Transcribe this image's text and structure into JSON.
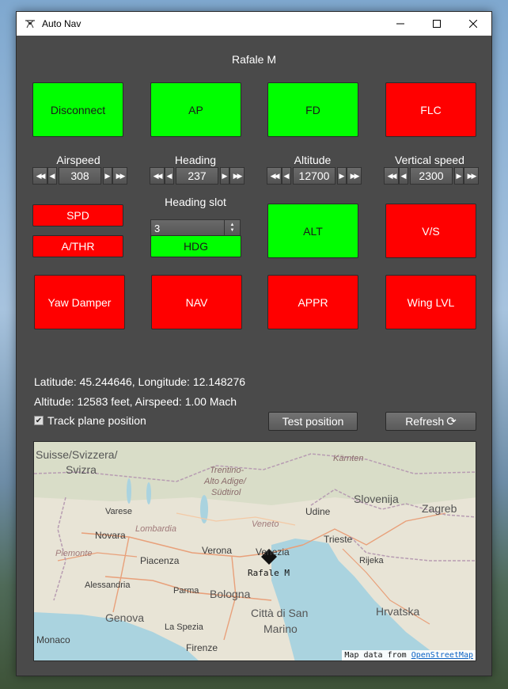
{
  "window": {
    "title": "Auto Nav"
  },
  "plane": {
    "name": "Rafale M"
  },
  "mode_buttons": {
    "disconnect": "Disconnect",
    "ap": "AP",
    "fd": "FD",
    "flc": "FLC",
    "spd": "SPD",
    "athr": "A/THR",
    "hdg": "HDG",
    "alt": "ALT",
    "vs": "V/S",
    "yaw_damper": "Yaw Damper",
    "nav": "NAV",
    "appr": "APPR",
    "wing_lvl": "Wing LVL"
  },
  "button_states": {
    "disconnect": "on",
    "ap": "on",
    "fd": "on",
    "flc": "off",
    "spd": "off",
    "athr": "off",
    "hdg": "on",
    "alt": "on",
    "vs": "off",
    "yaw_damper": "off",
    "nav": "off",
    "appr": "off",
    "wing_lvl": "off"
  },
  "colors": {
    "on": "#00ff00",
    "off": "#ff0000",
    "panel": "#4a4a4a"
  },
  "params": {
    "airspeed": {
      "label": "Airspeed",
      "value": "308"
    },
    "heading": {
      "label": "Heading",
      "value": "237"
    },
    "altitude": {
      "label": "Altitude",
      "value": "12700"
    },
    "vertical_speed": {
      "label": "Vertical speed",
      "value": "2300"
    }
  },
  "heading_slot": {
    "label": "Heading slot",
    "value": "3"
  },
  "position": {
    "lat_lon": "Latitude: 45.244646, Longitude: 12.148276",
    "alt_speed": "Altitude: 12583 feet, Airspeed: 1.00 Mach"
  },
  "track": {
    "label": "Track plane position",
    "checked": true
  },
  "actions": {
    "test_position": "Test position",
    "refresh": "Refresh"
  },
  "map": {
    "marker_label": "Rafale M",
    "attribution_text": "Map data from",
    "attribution_link": "OpenStreetMap",
    "labels": {
      "suisse": "Suisse/Svizzera/",
      "svizra": "Svizra",
      "karnten": "Kärnten",
      "trentino1": "Trentino-",
      "trentino2": "Alto Adige/",
      "trentino3": "Südtirol",
      "slovenija": "Slovenija",
      "zagreb": "Zagreb",
      "varese": "Varese",
      "udine": "Udine",
      "lombardia": "Lombardia",
      "veneto": "Veneto",
      "novara": "Novara",
      "trieste": "Trieste",
      "piemonte": "Piemonte",
      "verona": "Verona",
      "venezia": "Venezia",
      "piacenza": "Piacenza",
      "rijeka": "Rijeka",
      "alessandria": "Alessandria",
      "parma": "Parma",
      "bologna": "Bologna",
      "genova": "Genova",
      "citta": "Città di San",
      "marino": "Marino",
      "hrvatska": "Hrvatska",
      "laspezia": "La Spezia",
      "monaco": "Monaco",
      "firenze": "Firenze"
    }
  }
}
